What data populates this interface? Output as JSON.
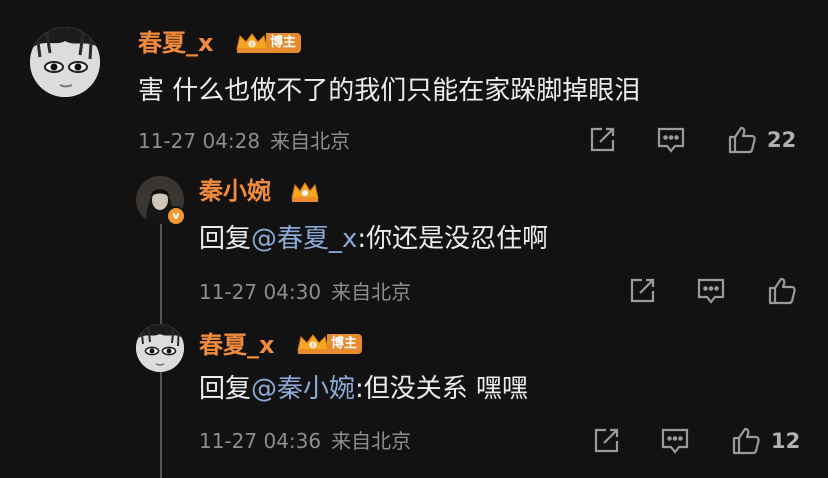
{
  "comments": [
    {
      "username": "春夏_x",
      "badge": "博主",
      "text": "害 什么也做不了的我们只能在家跺脚掉眼泪",
      "time": "11-27 04:28",
      "location": "来自北京",
      "likes": "22"
    },
    {
      "username": "秦小婉",
      "verified_mark": "v",
      "reply_prefix": "回复",
      "mention": "@春夏_x",
      "text": ":你还是没忍住啊",
      "time": "11-27 04:30",
      "location": "来自北京",
      "likes": ""
    },
    {
      "username": "春夏_x",
      "badge": "博主",
      "reply_prefix": "回复",
      "mention": "@秦小婉",
      "text": ":但没关系 嘿嘿",
      "time": "11-27 04:36",
      "location": "来自北京",
      "likes": "12"
    }
  ],
  "icons": {
    "share": "share-icon",
    "comment": "comment-icon",
    "like": "thumbs-up-icon",
    "crown": "crown-icon"
  },
  "colors": {
    "background": "#121212",
    "username": "#f08a3c",
    "mention": "#8aa9d6",
    "meta": "#8d8d8d",
    "badge": "#e88a2e"
  }
}
